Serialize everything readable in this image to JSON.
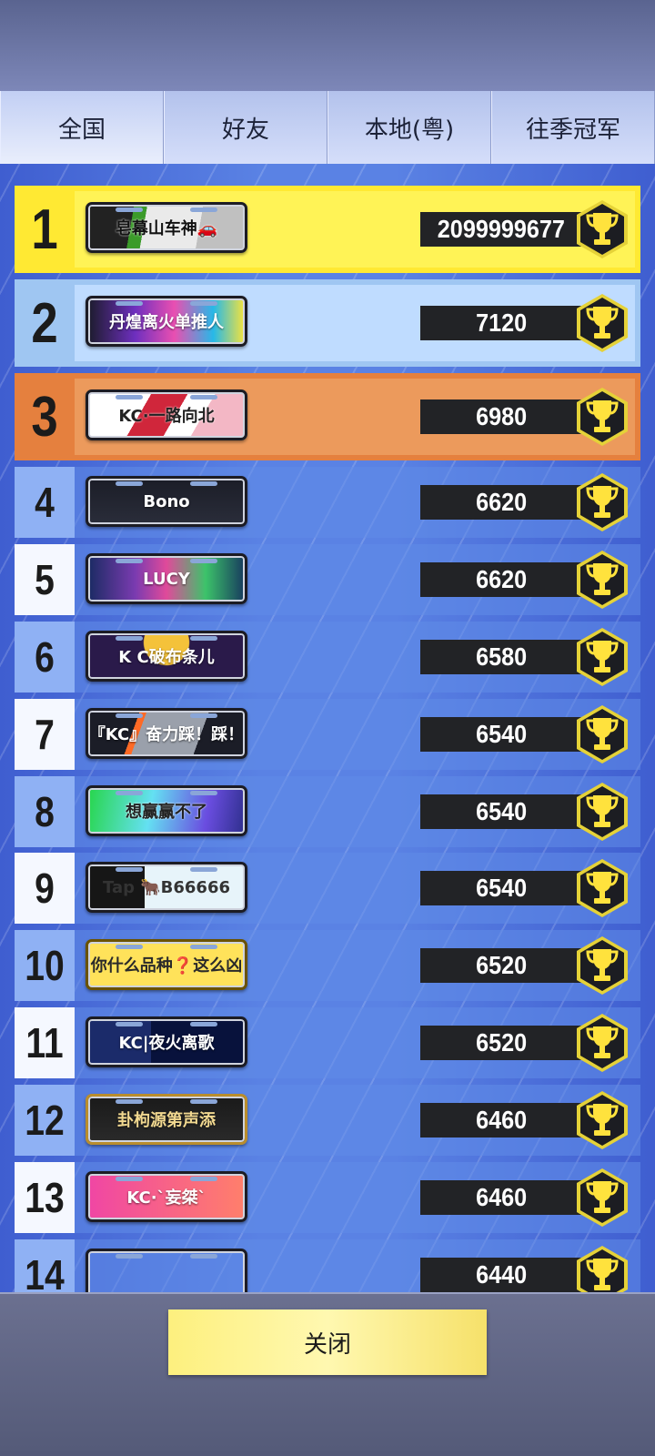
{
  "tabs": [
    {
      "label": "全国",
      "active": true
    },
    {
      "label": "好友",
      "active": false
    },
    {
      "label": "本地(粤)",
      "active": false
    },
    {
      "label": "往季冠军",
      "active": false
    }
  ],
  "entries": [
    {
      "rank": "1",
      "name": "皂幕山车神🚗",
      "score": "2099999677"
    },
    {
      "rank": "2",
      "name": "丹煌离火单推人",
      "score": "7120"
    },
    {
      "rank": "3",
      "name": "KC·一路向北",
      "score": "6980"
    },
    {
      "rank": "4",
      "name": "Bono",
      "score": "6620"
    },
    {
      "rank": "5",
      "name": "LUCY",
      "score": "6620"
    },
    {
      "rank": "6",
      "name": "K C破布条儿",
      "score": "6580"
    },
    {
      "rank": "7",
      "name": "『KC』奋力踩！踩！",
      "score": "6540"
    },
    {
      "rank": "8",
      "name": "想赢赢不了",
      "score": "6540"
    },
    {
      "rank": "9",
      "name": "Tap 🐂B66666",
      "score": "6540"
    },
    {
      "rank": "10",
      "name": "你什么品种❓这么凶",
      "score": "6520"
    },
    {
      "rank": "11",
      "name": "KC|夜火离歌",
      "score": "6520"
    },
    {
      "rank": "12",
      "name": "卦枸源第声添",
      "score": "6460"
    },
    {
      "rank": "13",
      "name": "KC·`妄桀`",
      "score": "6460"
    },
    {
      "rank": "14",
      "name": "",
      "score": "6440"
    }
  ],
  "close_label": "关闭",
  "colors": {
    "rank1": "#ffe933",
    "rank2": "#9fc6f2",
    "rank3": "#e5803e",
    "trophy": "#e5d238",
    "score_bg": "#222326"
  },
  "icons": {
    "trophy": "trophy-icon"
  }
}
